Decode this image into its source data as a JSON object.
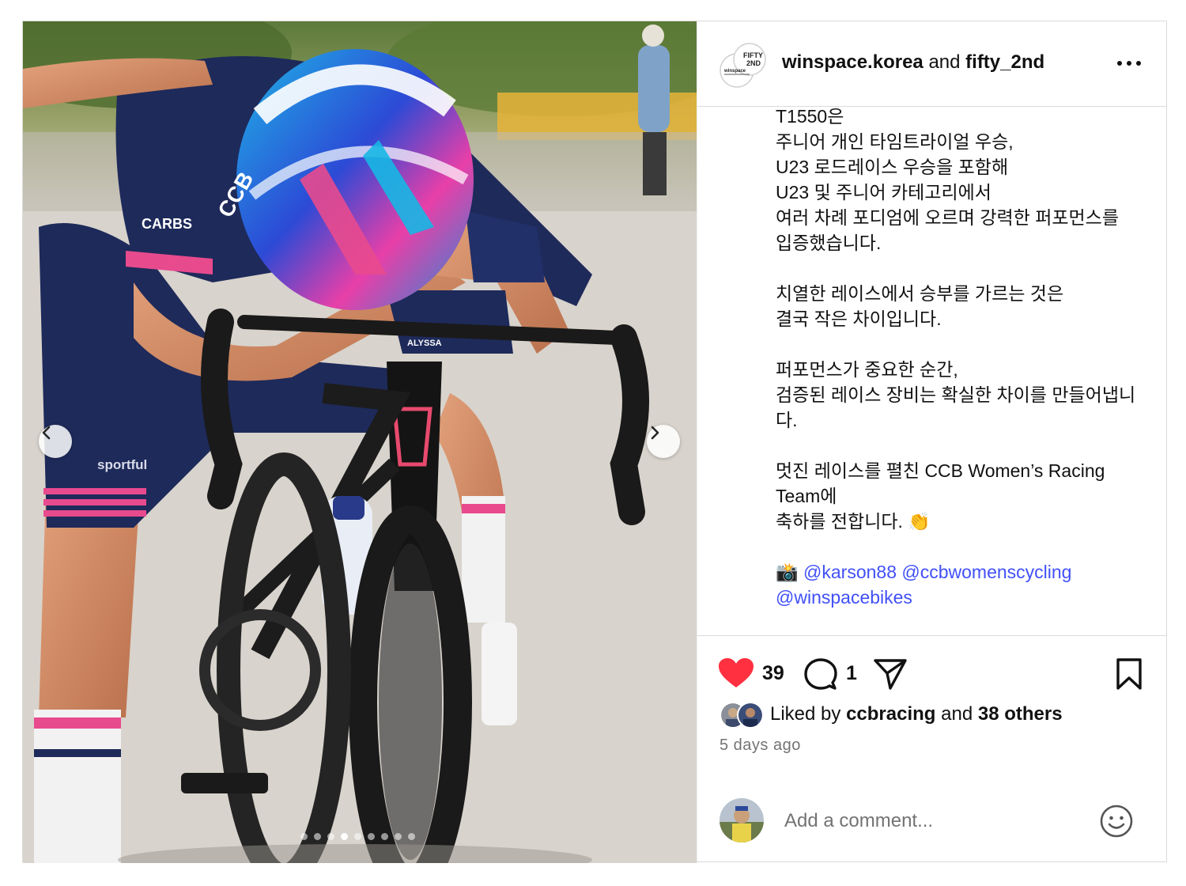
{
  "post": {
    "header": {
      "account": "winspace.korea",
      "conjunction": "and",
      "collaborator": "fifty_2nd",
      "avatar_logo_text": "FIFTY 2ND winspace",
      "more_icon": "more-horizontal-icon"
    },
    "media": {
      "description_icon": "photo",
      "helmet_text": "CCB",
      "glove_text": "ALYSSA",
      "sleeve_text": "CARBS",
      "shorts_text": "sportful",
      "carousel": {
        "total": 9,
        "active_index": 3
      },
      "prev_icon": "chevron-left-icon",
      "next_icon": "chevron-right-icon"
    },
    "caption": {
      "lines_block1": [
        "T1550은",
        "주니어 개인 타임트라이얼 우승,",
        "U23 로드레이스 우승을 포함해",
        "U23 및 주니어 카테고리에서",
        "여러 차례 포디엄에 오르며 강력한 퍼포먼스를",
        "입증했습니다."
      ],
      "lines_block2": [
        "치열한 레이스에서 승부를 가르는 것은",
        "결국 작은 차이입니다."
      ],
      "lines_block3": [
        "퍼포먼스가 중요한 순간,",
        "검증된 레이스 장비는 확실한 차이를 만들어냅니",
        "다."
      ],
      "lines_block4": [
        "멋진 레이스를 펼친 CCB Women’s Racing",
        "Team에",
        "축하를 전합니다. 👏"
      ],
      "camera_emoji": "📸",
      "mentions": [
        "@karson88",
        "@ccbwomenscycling",
        "@winspacebikes"
      ]
    },
    "actions": {
      "like_count": "39",
      "comment_count": "1",
      "liked": true,
      "like_color": "#ff3040"
    },
    "likes": {
      "prefix": "Liked by",
      "user": "ccbracing",
      "conjunction": "and",
      "others": "38 others"
    },
    "timestamp": "5 days ago",
    "comment": {
      "placeholder": "Add a comment..."
    }
  }
}
